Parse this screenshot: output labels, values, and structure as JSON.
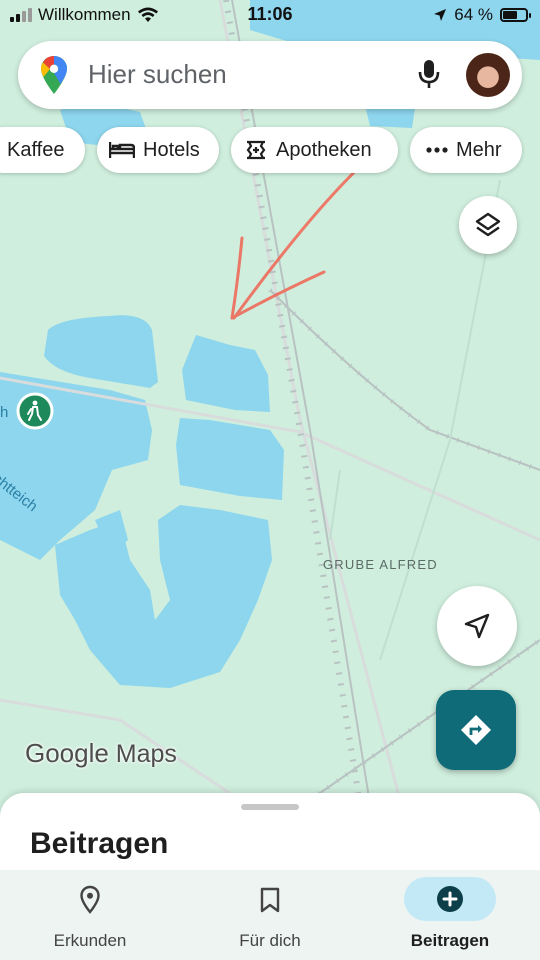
{
  "status_bar": {
    "carrier": "Willkommen",
    "time": "11:06",
    "battery": "64 %",
    "battery_level": 0.64
  },
  "search": {
    "placeholder": "Hier suchen"
  },
  "chips": [
    {
      "label": "Kaffee",
      "icon": "coffee-icon"
    },
    {
      "label": "Hotels",
      "icon": "bed-icon"
    },
    {
      "label": "Apotheken",
      "icon": "pharmacy-icon"
    },
    {
      "label": "Mehr",
      "icon": "more-dots-icon"
    }
  ],
  "map": {
    "place_label": "GRUBE ALFRED",
    "lake_label_partial": "chtteich",
    "brand_google": "Google",
    "brand_maps": "Maps",
    "colors": {
      "land": "#cfeedd",
      "water": "#8dd6ee",
      "accent": "#0f6b78",
      "annotation": "#ef6b5b"
    }
  },
  "bottom_sheet": {
    "title": "Beitragen"
  },
  "nav": {
    "tabs": [
      {
        "label": "Erkunden",
        "icon": "location-pin-icon",
        "active": false
      },
      {
        "label": "Für dich",
        "icon": "bookmark-icon",
        "active": false
      },
      {
        "label": "Beitragen",
        "icon": "add-circle-icon",
        "active": true
      }
    ]
  }
}
